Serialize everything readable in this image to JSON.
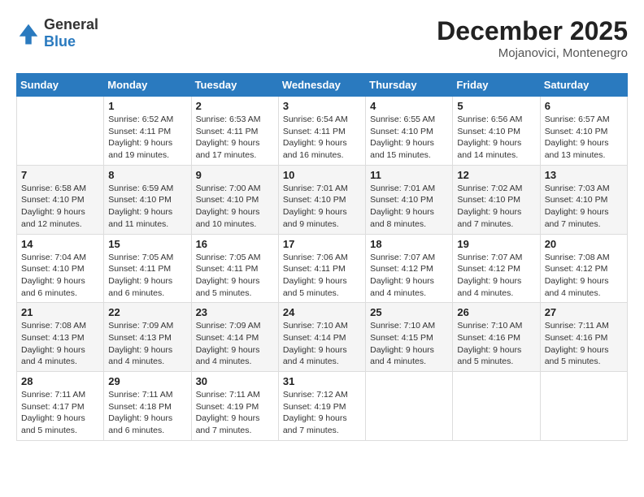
{
  "logo": {
    "text_general": "General",
    "text_blue": "Blue"
  },
  "title": "December 2025",
  "location": "Mojanovici, Montenegro",
  "days_of_week": [
    "Sunday",
    "Monday",
    "Tuesday",
    "Wednesday",
    "Thursday",
    "Friday",
    "Saturday"
  ],
  "weeks": [
    [
      {
        "day": "",
        "info": ""
      },
      {
        "day": "1",
        "info": "Sunrise: 6:52 AM\nSunset: 4:11 PM\nDaylight: 9 hours\nand 19 minutes."
      },
      {
        "day": "2",
        "info": "Sunrise: 6:53 AM\nSunset: 4:11 PM\nDaylight: 9 hours\nand 17 minutes."
      },
      {
        "day": "3",
        "info": "Sunrise: 6:54 AM\nSunset: 4:11 PM\nDaylight: 9 hours\nand 16 minutes."
      },
      {
        "day": "4",
        "info": "Sunrise: 6:55 AM\nSunset: 4:10 PM\nDaylight: 9 hours\nand 15 minutes."
      },
      {
        "day": "5",
        "info": "Sunrise: 6:56 AM\nSunset: 4:10 PM\nDaylight: 9 hours\nand 14 minutes."
      },
      {
        "day": "6",
        "info": "Sunrise: 6:57 AM\nSunset: 4:10 PM\nDaylight: 9 hours\nand 13 minutes."
      }
    ],
    [
      {
        "day": "7",
        "info": "Sunrise: 6:58 AM\nSunset: 4:10 PM\nDaylight: 9 hours\nand 12 minutes."
      },
      {
        "day": "8",
        "info": "Sunrise: 6:59 AM\nSunset: 4:10 PM\nDaylight: 9 hours\nand 11 minutes."
      },
      {
        "day": "9",
        "info": "Sunrise: 7:00 AM\nSunset: 4:10 PM\nDaylight: 9 hours\nand 10 minutes."
      },
      {
        "day": "10",
        "info": "Sunrise: 7:01 AM\nSunset: 4:10 PM\nDaylight: 9 hours\nand 9 minutes."
      },
      {
        "day": "11",
        "info": "Sunrise: 7:01 AM\nSunset: 4:10 PM\nDaylight: 9 hours\nand 8 minutes."
      },
      {
        "day": "12",
        "info": "Sunrise: 7:02 AM\nSunset: 4:10 PM\nDaylight: 9 hours\nand 7 minutes."
      },
      {
        "day": "13",
        "info": "Sunrise: 7:03 AM\nSunset: 4:10 PM\nDaylight: 9 hours\nand 7 minutes."
      }
    ],
    [
      {
        "day": "14",
        "info": "Sunrise: 7:04 AM\nSunset: 4:10 PM\nDaylight: 9 hours\nand 6 minutes."
      },
      {
        "day": "15",
        "info": "Sunrise: 7:05 AM\nSunset: 4:11 PM\nDaylight: 9 hours\nand 6 minutes."
      },
      {
        "day": "16",
        "info": "Sunrise: 7:05 AM\nSunset: 4:11 PM\nDaylight: 9 hours\nand 5 minutes."
      },
      {
        "day": "17",
        "info": "Sunrise: 7:06 AM\nSunset: 4:11 PM\nDaylight: 9 hours\nand 5 minutes."
      },
      {
        "day": "18",
        "info": "Sunrise: 7:07 AM\nSunset: 4:12 PM\nDaylight: 9 hours\nand 4 minutes."
      },
      {
        "day": "19",
        "info": "Sunrise: 7:07 AM\nSunset: 4:12 PM\nDaylight: 9 hours\nand 4 minutes."
      },
      {
        "day": "20",
        "info": "Sunrise: 7:08 AM\nSunset: 4:12 PM\nDaylight: 9 hours\nand 4 minutes."
      }
    ],
    [
      {
        "day": "21",
        "info": "Sunrise: 7:08 AM\nSunset: 4:13 PM\nDaylight: 9 hours\nand 4 minutes."
      },
      {
        "day": "22",
        "info": "Sunrise: 7:09 AM\nSunset: 4:13 PM\nDaylight: 9 hours\nand 4 minutes."
      },
      {
        "day": "23",
        "info": "Sunrise: 7:09 AM\nSunset: 4:14 PM\nDaylight: 9 hours\nand 4 minutes."
      },
      {
        "day": "24",
        "info": "Sunrise: 7:10 AM\nSunset: 4:14 PM\nDaylight: 9 hours\nand 4 minutes."
      },
      {
        "day": "25",
        "info": "Sunrise: 7:10 AM\nSunset: 4:15 PM\nDaylight: 9 hours\nand 4 minutes."
      },
      {
        "day": "26",
        "info": "Sunrise: 7:10 AM\nSunset: 4:16 PM\nDaylight: 9 hours\nand 5 minutes."
      },
      {
        "day": "27",
        "info": "Sunrise: 7:11 AM\nSunset: 4:16 PM\nDaylight: 9 hours\nand 5 minutes."
      }
    ],
    [
      {
        "day": "28",
        "info": "Sunrise: 7:11 AM\nSunset: 4:17 PM\nDaylight: 9 hours\nand 5 minutes."
      },
      {
        "day": "29",
        "info": "Sunrise: 7:11 AM\nSunset: 4:18 PM\nDaylight: 9 hours\nand 6 minutes."
      },
      {
        "day": "30",
        "info": "Sunrise: 7:11 AM\nSunset: 4:19 PM\nDaylight: 9 hours\nand 7 minutes."
      },
      {
        "day": "31",
        "info": "Sunrise: 7:12 AM\nSunset: 4:19 PM\nDaylight: 9 hours\nand 7 minutes."
      },
      {
        "day": "",
        "info": ""
      },
      {
        "day": "",
        "info": ""
      },
      {
        "day": "",
        "info": ""
      }
    ]
  ]
}
